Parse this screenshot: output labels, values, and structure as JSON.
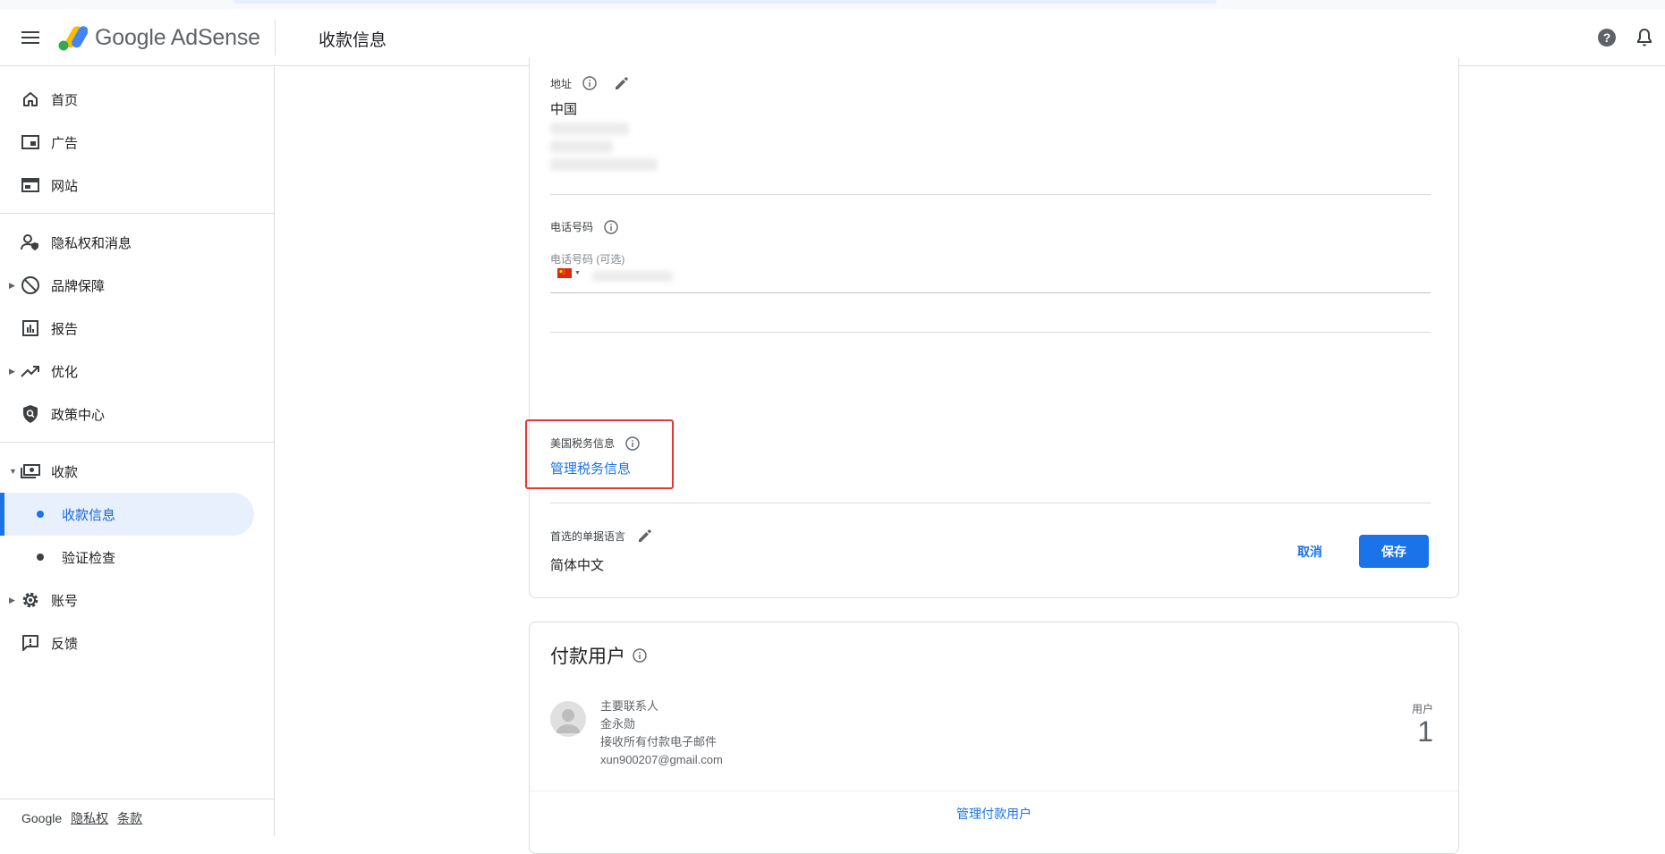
{
  "header": {
    "brand": "Google AdSense",
    "page_title": "收款信息"
  },
  "sidebar": {
    "items": [
      {
        "label": "首页",
        "icon": "home-icon"
      },
      {
        "label": "广告",
        "icon": "ads-icon"
      },
      {
        "label": "网站",
        "icon": "sites-icon"
      },
      {
        "label": "隐私权和消息",
        "icon": "privacy-icon"
      },
      {
        "label": "品牌保障",
        "icon": "block-icon"
      },
      {
        "label": "报告",
        "icon": "reports-icon"
      },
      {
        "label": "优化",
        "icon": "trending-icon"
      },
      {
        "label": "政策中心",
        "icon": "policy-shield-icon"
      },
      {
        "label": "收款",
        "icon": "payments-icon"
      },
      {
        "label": "账号",
        "icon": "gear-icon"
      },
      {
        "label": "反馈",
        "icon": "feedback-icon"
      }
    ],
    "payments_sub": [
      {
        "label": "收款信息",
        "active": true
      },
      {
        "label": "验证检查",
        "active": false
      }
    ],
    "footer": {
      "google": "Google",
      "privacy": "隐私权",
      "terms": "条款"
    }
  },
  "form": {
    "address": {
      "label": "地址",
      "country": "中国"
    },
    "phone": {
      "label": "电话号码",
      "field_label": "电话号码 (可选)"
    },
    "tax": {
      "label": "美国税务信息",
      "link": "管理税务信息"
    },
    "language": {
      "label": "首选的单据语言",
      "value": "简体中文"
    },
    "cancel_label": "取消",
    "save_label": "保存"
  },
  "payment_users": {
    "title": "付款用户",
    "role": "主要联系人",
    "name": "金永勋",
    "notice": "接收所有付款电子邮件",
    "email": "xun900207@gmail.com",
    "count_label": "用户",
    "count": "1",
    "manage_link": "管理付款用户"
  },
  "colors": {
    "accent": "#1a73e8",
    "highlight_border": "#e53935",
    "active_nav_bg": "#e8f0fe"
  }
}
